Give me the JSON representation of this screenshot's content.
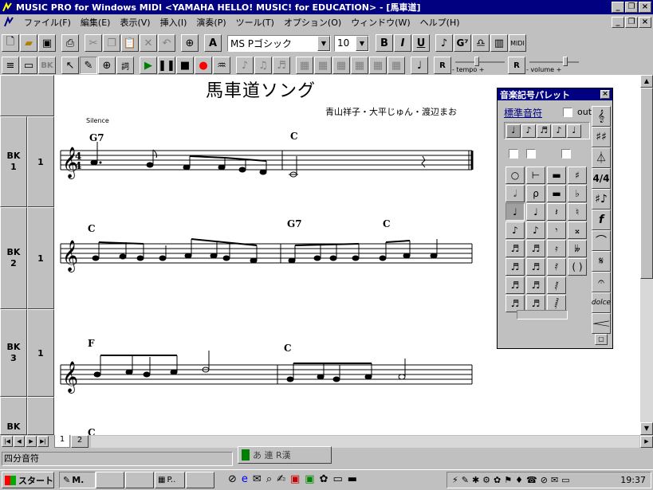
{
  "window": {
    "title": "MUSIC PRO for Windows MIDI <YAMAHA HELLO! MUSIC! for EDUCATION> - [馬車道]"
  },
  "menu": [
    "ファイル(F)",
    "編集(E)",
    "表示(V)",
    "挿入(I)",
    "演奏(P)",
    "ツール(T)",
    "オプション(O)",
    "ウィンドウ(W)",
    "ヘルプ(H)"
  ],
  "toolbar": {
    "font_name": "MS Pゴシック",
    "font_size": "10",
    "bold": "B",
    "italic": "I",
    "underline": "U",
    "chord_symbol": "G⁷",
    "midi": "MIDI",
    "text_tool": "A"
  },
  "toolbar2": {
    "bk": "BK",
    "tempo_label": "- tempo +",
    "volume_label": "- volume +",
    "r1": "R",
    "r2": "R"
  },
  "score": {
    "title": "馬車道ソング",
    "composer": "青山祥子・大平じゅん・渡辺まお",
    "silence": "Silence",
    "chords": [
      "G7",
      "C",
      "C",
      "G7",
      "C",
      "F",
      "C"
    ],
    "tab_label": "C",
    "timesig_top": "4",
    "timesig_bottom": "4"
  },
  "blocks": [
    {
      "name": "BK\n1",
      "num": "1"
    },
    {
      "name": "BK\n2",
      "num": "1"
    },
    {
      "name": "BK\n3",
      "num": "1"
    },
    {
      "name": "BK",
      "num": ""
    }
  ],
  "tabs": [
    "1",
    "2"
  ],
  "status": {
    "text": "四分音符",
    "ime": "あ 連 R漢"
  },
  "palette": {
    "title": "音楽記号パレット",
    "mode": "標準音符",
    "out_label": "out",
    "dolce": "dolce"
  },
  "taskbar": {
    "start": "スタート",
    "tasks": [
      "M.",
      "P.."
    ],
    "clock": "19:37"
  }
}
